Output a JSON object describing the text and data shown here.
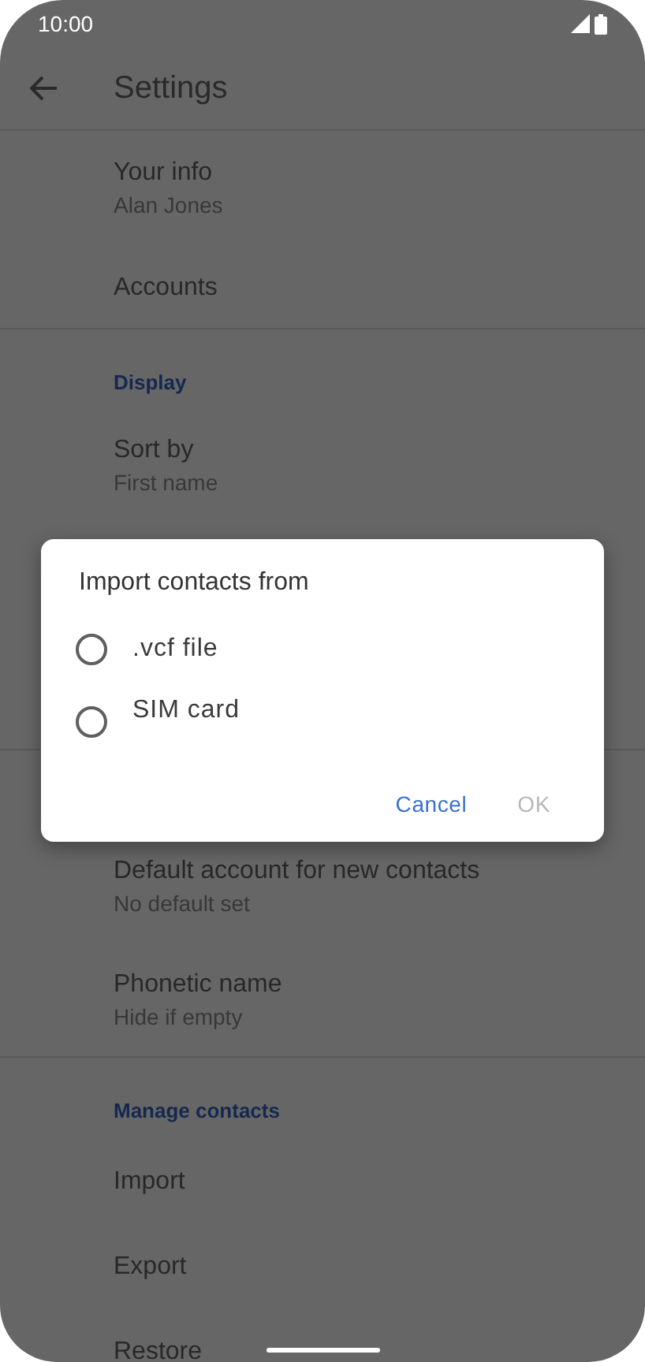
{
  "status_bar": {
    "time": "10:00"
  },
  "app_bar": {
    "title": "Settings"
  },
  "settings": [
    {
      "kind": "item",
      "title": "Your info",
      "subtitle": "Alan Jones"
    },
    {
      "kind": "item",
      "title": "Accounts"
    },
    {
      "kind": "divider"
    },
    {
      "kind": "category",
      "title": "Display"
    },
    {
      "kind": "item",
      "title": "Sort by",
      "subtitle": "First name"
    },
    {
      "kind": "hidden"
    },
    {
      "kind": "item",
      "title": "Default account for new contacts",
      "subtitle": "No default set"
    },
    {
      "kind": "item",
      "title": "Phonetic name",
      "subtitle": "Hide if empty"
    },
    {
      "kind": "divider"
    },
    {
      "kind": "category",
      "title": "Manage contacts"
    },
    {
      "kind": "item",
      "title": "Import"
    },
    {
      "kind": "item",
      "title": "Export"
    },
    {
      "kind": "item",
      "title": "Restore"
    }
  ],
  "dialog": {
    "title": "Import contacts from",
    "options": [
      {
        "label": ".vcf file",
        "selected": false
      },
      {
        "label": "SIM card",
        "selected": false
      }
    ],
    "buttons": [
      {
        "label": "Cancel",
        "disabled": false
      },
      {
        "label": "OK",
        "disabled": true
      }
    ]
  }
}
